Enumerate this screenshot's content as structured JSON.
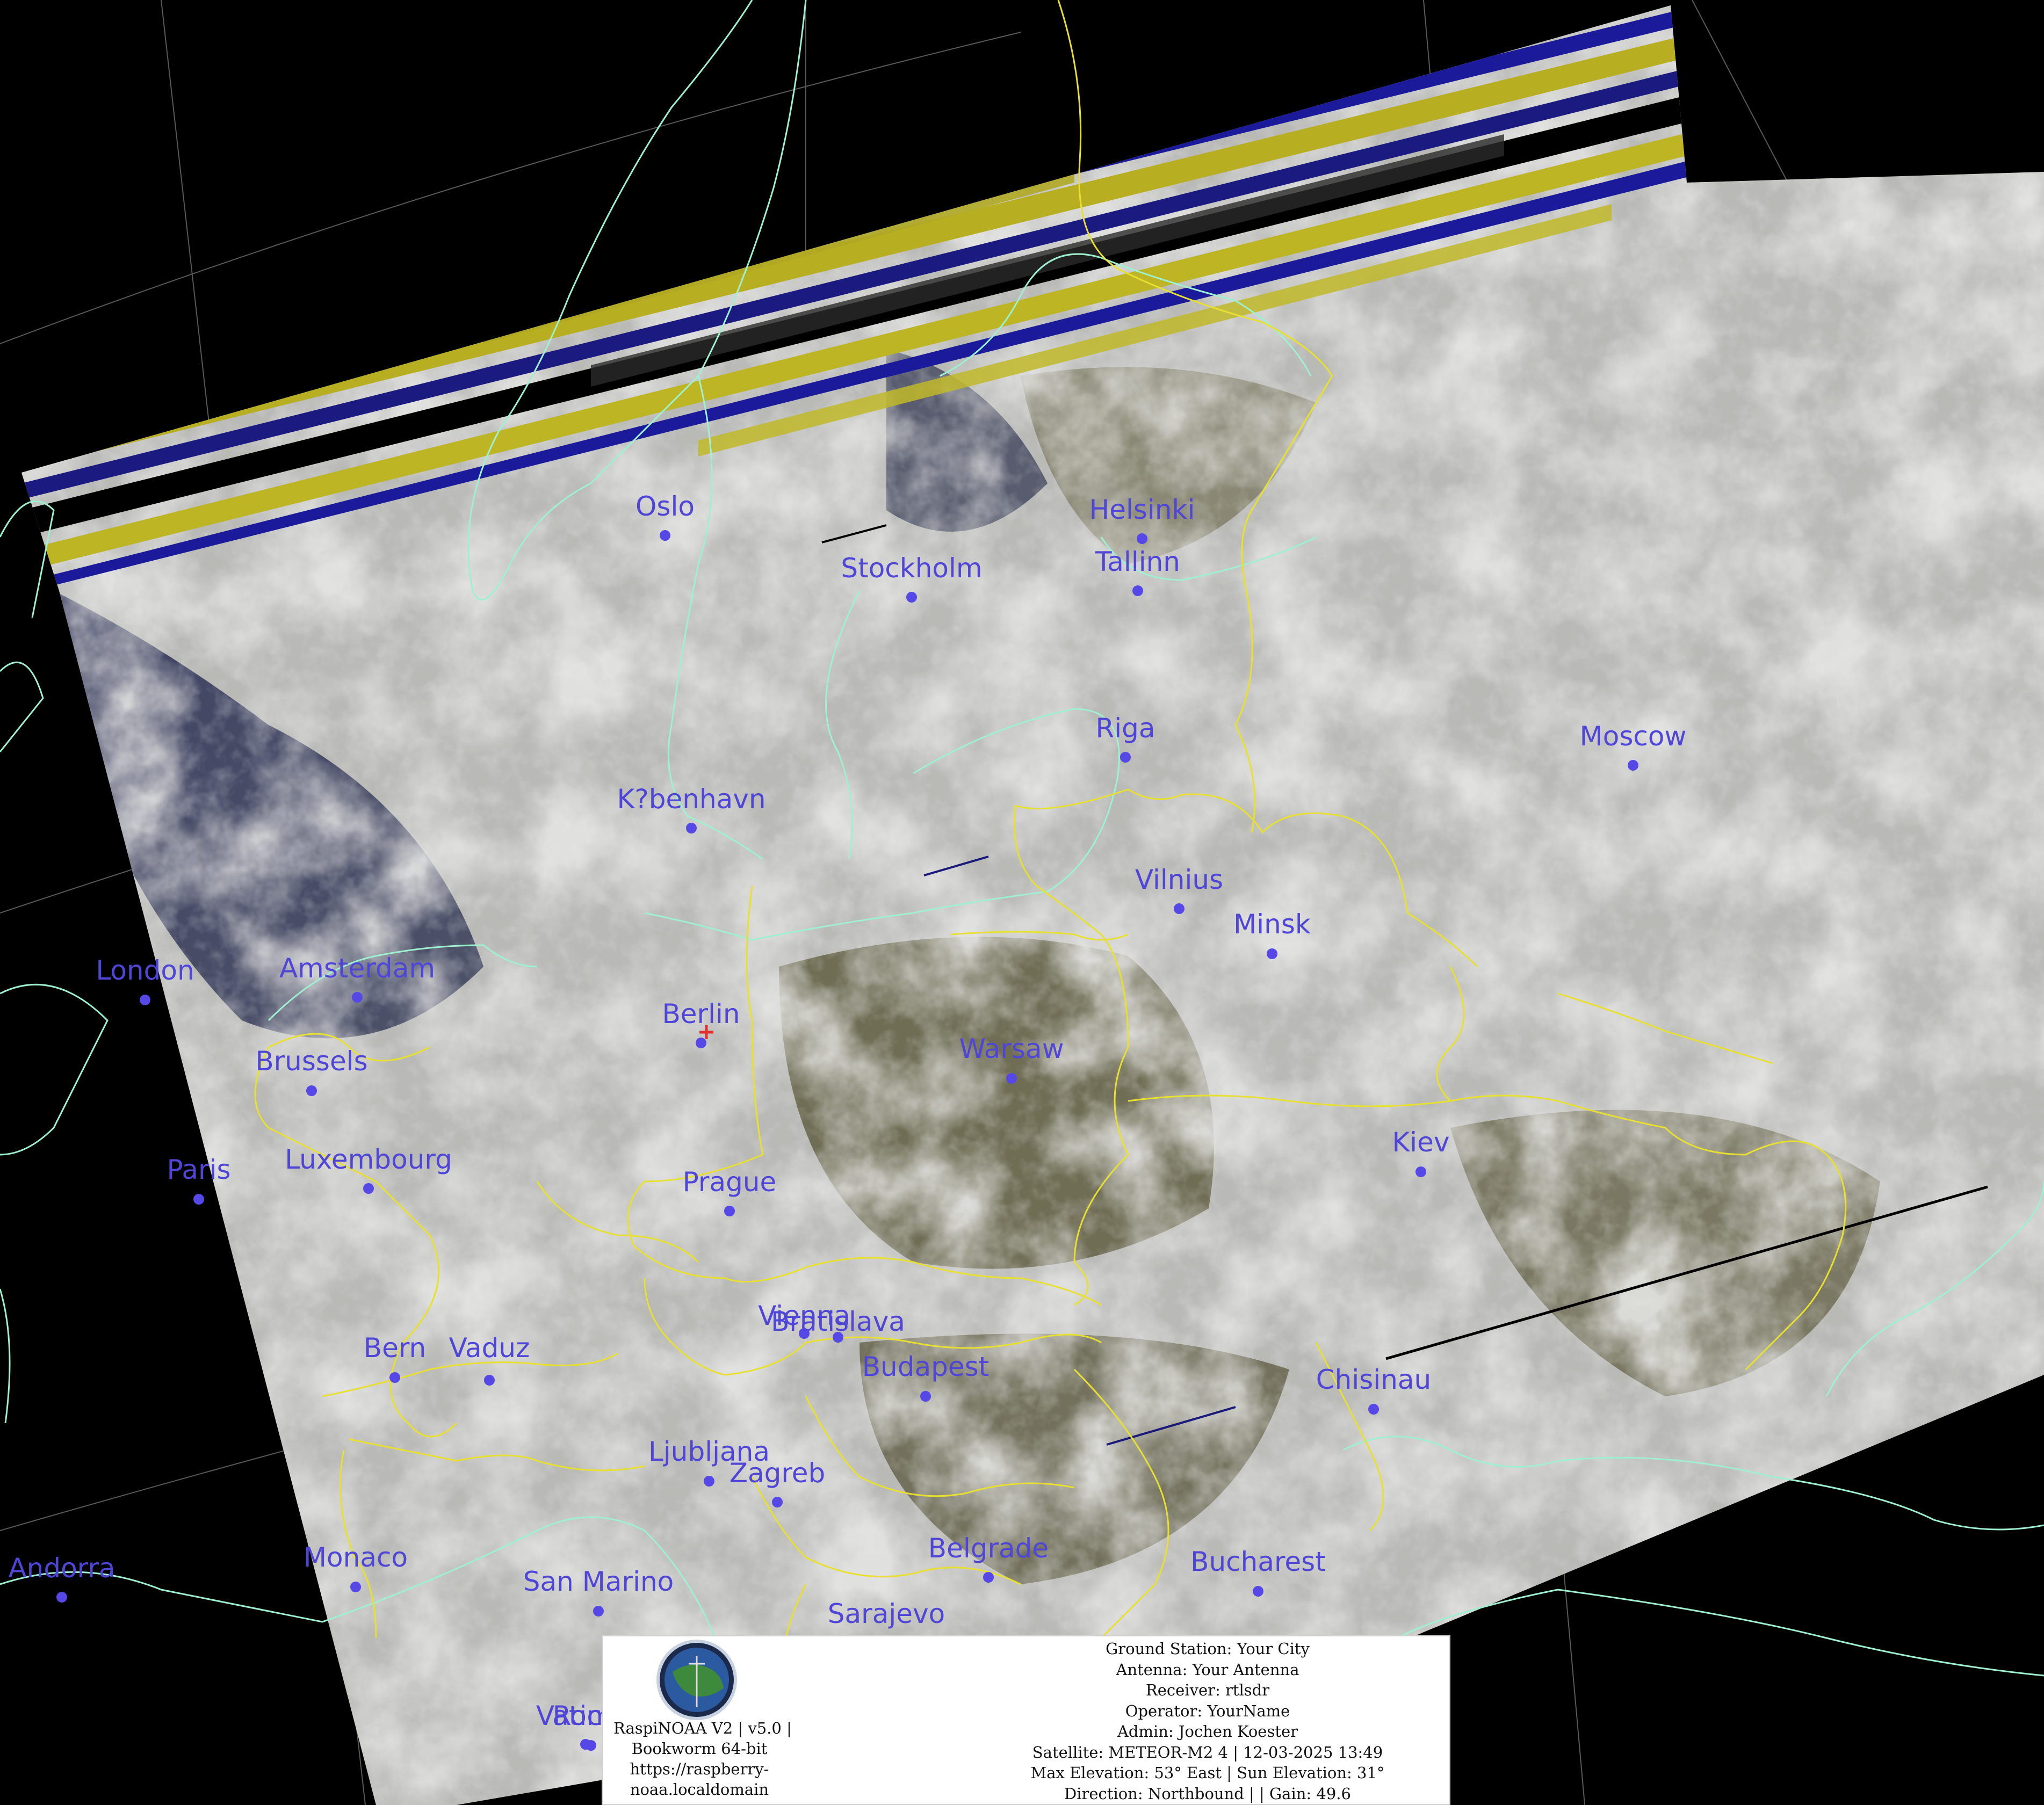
{
  "cities": [
    {
      "id": "oslo",
      "name": "Oslo"
    },
    {
      "id": "helsinki",
      "name": "Helsinki"
    },
    {
      "id": "stockholm",
      "name": "Stockholm"
    },
    {
      "id": "tallinn",
      "name": "Tallinn"
    },
    {
      "id": "riga",
      "name": "Riga"
    },
    {
      "id": "moscow",
      "name": "Moscow"
    },
    {
      "id": "kobenhavn",
      "name": "K?benhavn"
    },
    {
      "id": "vilnius",
      "name": "Vilnius"
    },
    {
      "id": "minsk",
      "name": "Minsk"
    },
    {
      "id": "london",
      "name": "London"
    },
    {
      "id": "amsterdam",
      "name": "Amsterdam"
    },
    {
      "id": "berlin",
      "name": "Berlin"
    },
    {
      "id": "brussels",
      "name": "Brussels"
    },
    {
      "id": "warsaw",
      "name": "Warsaw"
    },
    {
      "id": "paris",
      "name": "Paris"
    },
    {
      "id": "luxembourg",
      "name": "Luxembourg"
    },
    {
      "id": "kiev",
      "name": "Kiev"
    },
    {
      "id": "prague",
      "name": "Prague"
    },
    {
      "id": "vienna",
      "name": "Vienna"
    },
    {
      "id": "bratislava",
      "name": "Bratislava"
    },
    {
      "id": "budapest",
      "name": "Budapest"
    },
    {
      "id": "bern",
      "name": "Bern"
    },
    {
      "id": "vaduz",
      "name": "Vaduz"
    },
    {
      "id": "chisinau",
      "name": "Chisinau"
    },
    {
      "id": "ljubljana",
      "name": "Ljubljana"
    },
    {
      "id": "zagreb",
      "name": "Zagreb"
    },
    {
      "id": "andorra",
      "name": "Andorra"
    },
    {
      "id": "monaco",
      "name": "Monaco"
    },
    {
      "id": "belgrade",
      "name": "Belgrade"
    },
    {
      "id": "bucharest",
      "name": "Bucharest"
    },
    {
      "id": "san_marino",
      "name": "San Marino"
    },
    {
      "id": "sarajevo",
      "name": "Sarajevo"
    },
    {
      "id": "vatican",
      "name": "Vatican"
    },
    {
      "id": "rome",
      "name": "Rome"
    }
  ],
  "info": {
    "software_lines": [
      "RaspiNOAA V2 | v5.0 |",
      "Bookworm 64-bit",
      "https://raspberry-",
      "noaa.localdomain"
    ],
    "station_lines": [
      "Ground Station: Your City",
      "Antenna: Your Antenna",
      "Receiver: rtlsdr",
      "Operator: YourName",
      "Admin: Jochen Koester",
      "Satellite: METEOR-M2 4 | 12-03-2025 13:49",
      "Max Elevation: 53° East | Sun Elevation: 31°",
      "Direction: Northbound | | Gain: 49.6"
    ]
  },
  "colors": {
    "background": "#000000",
    "coastline": "#9ff0d0",
    "border": "#e8e030",
    "city": "#4f46d8",
    "graticule": "#7a7a7a",
    "cloud": "#c9c9c9",
    "land": "#5a5a3a",
    "artifact_yellow": "#b8b020",
    "artifact_blue": "#1a1a9a"
  }
}
